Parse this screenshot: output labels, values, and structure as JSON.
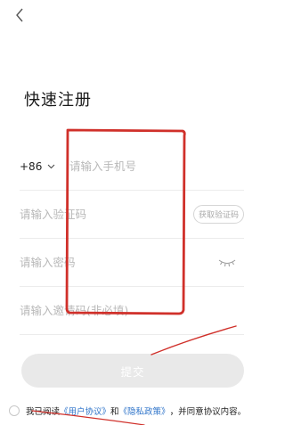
{
  "title": "快速注册",
  "phone": {
    "country_code": "+86",
    "placeholder": "请输入手机号"
  },
  "verify": {
    "placeholder": "请输入验证码",
    "button_label": "获取验证码"
  },
  "password": {
    "placeholder": "请输入密码"
  },
  "invite": {
    "placeholder": "请输入邀请码(非必填)"
  },
  "submit_label": "提交",
  "agreement": {
    "prefix": "我已阅读",
    "user_agreement": "《用户协议》",
    "and": "和",
    "privacy_policy": "《隐私政策》",
    "suffix": "，并同意协议内容。"
  },
  "colors": {
    "annotation_red": "#d0302a",
    "link_blue": "#2d73c9",
    "button_disabled": "#e9e9e9"
  }
}
